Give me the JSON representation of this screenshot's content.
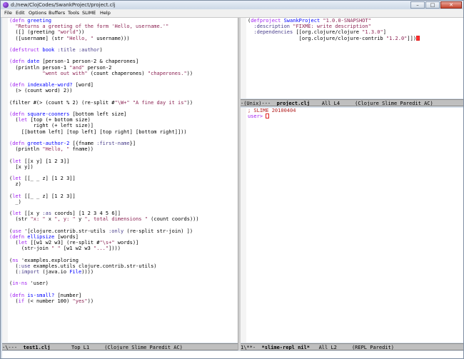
{
  "window": {
    "title": "d:/new/ClojCodes/SwankProject/project.clj",
    "min": "–",
    "max": "□",
    "close": "✕"
  },
  "menu": [
    "File",
    "Edit",
    "Options",
    "Buffers",
    "Tools",
    "SLIME",
    "Help"
  ],
  "left_code": [
    [
      [
        "kw",
        "(defn "
      ],
      [
        "fn",
        "greeting"
      ]
    ],
    [
      [
        "str",
        "  \"Returns a greeting of the form 'Hello, username.'\""
      ]
    ],
    [
      [
        "",
        "  ([] (greeting "
      ],
      [
        "str",
        "\"world\""
      ],
      [
        "",
        "))"
      ]
    ],
    [
      [
        "",
        "  ([username] (str "
      ],
      [
        "str",
        "\"Hello, \""
      ],
      [
        "",
        " username)))"
      ]
    ],
    [
      [
        "",
        ""
      ]
    ],
    [
      [
        "kw",
        "(defstruct "
      ],
      [
        "fn",
        "book"
      ],
      [
        "",
        " "
      ],
      [
        "key",
        ":title :author"
      ],
      [
        "",
        ")"
      ]
    ],
    [
      [
        "",
        ""
      ]
    ],
    [
      [
        "kw",
        "(defn "
      ],
      [
        "fn",
        "date"
      ],
      [
        "",
        " [person-1 person-2 & chaperones]"
      ]
    ],
    [
      [
        "",
        "  (println person-1 "
      ],
      [
        "str",
        "\"and\""
      ],
      [
        "",
        " person-2"
      ]
    ],
    [
      [
        "",
        "           "
      ],
      [
        "str",
        "\"went out with\""
      ],
      [
        "",
        " (count chaperones) "
      ],
      [
        "str",
        "\"chaperones.\""
      ],
      [
        "",
        "))"
      ]
    ],
    [
      [
        "",
        ""
      ]
    ],
    [
      [
        "kw",
        "(defn "
      ],
      [
        "fn",
        "indexable-word?"
      ],
      [
        "",
        " [word]"
      ]
    ],
    [
      [
        "",
        "  (> (count word) 2))"
      ]
    ],
    [
      [
        "",
        ""
      ]
    ],
    [
      [
        "",
        "(filter #(> (count % 2) (re-split #"
      ],
      [
        "str",
        "\"\\W+\" \"A fine day it is\""
      ],
      [
        "",
        "))"
      ]
    ],
    [
      [
        "",
        ""
      ]
    ],
    [
      [
        "kw",
        "(defn "
      ],
      [
        "fn",
        "square-cooners"
      ],
      [
        "",
        " [bottom left size]"
      ]
    ],
    [
      [
        "",
        "  ("
      ],
      [
        "kw",
        "let"
      ],
      [
        "",
        " [top (+ bottom size)"
      ]
    ],
    [
      [
        "",
        "        right (+ left size)]"
      ]
    ],
    [
      [
        "",
        "    [[bottom left] [top left] [top right] [bottom right]]))"
      ]
    ],
    [
      [
        "",
        ""
      ]
    ],
    [
      [
        "kw",
        "(defn "
      ],
      [
        "fn",
        "greet-author-2"
      ],
      [
        "",
        " [{fname "
      ],
      [
        "key",
        ":first-name"
      ],
      [
        "",
        "}]"
      ]
    ],
    [
      [
        "",
        "  (println "
      ],
      [
        "str",
        "\"Hello, \""
      ],
      [
        "",
        " fname))"
      ]
    ],
    [
      [
        "",
        ""
      ]
    ],
    [
      [
        "",
        "("
      ],
      [
        "kw",
        "let"
      ],
      [
        "",
        " [[x y] [1 2 3]]"
      ]
    ],
    [
      [
        "",
        "  [x y])"
      ]
    ],
    [
      [
        "",
        ""
      ]
    ],
    [
      [
        "",
        "("
      ],
      [
        "kw",
        "let"
      ],
      [
        "",
        " [[_ _ z] [1 2 3]]"
      ]
    ],
    [
      [
        "",
        "  z)"
      ]
    ],
    [
      [
        "",
        ""
      ]
    ],
    [
      [
        "",
        "("
      ],
      [
        "kw",
        "let"
      ],
      [
        "",
        " [[_ _ z] [1 2 3]]"
      ]
    ],
    [
      [
        "",
        "  _)"
      ]
    ],
    [
      [
        "",
        ""
      ]
    ],
    [
      [
        "",
        "("
      ],
      [
        "kw",
        "let"
      ],
      [
        "",
        " [[x y "
      ],
      [
        "key",
        ":as"
      ],
      [
        "",
        " coords] [1 2 3 4 5 6]]"
      ]
    ],
    [
      [
        "",
        "  (str "
      ],
      [
        "str",
        "\"x: \""
      ],
      [
        "",
        " x "
      ],
      [
        "str",
        "\", y: \""
      ],
      [
        "",
        " y "
      ],
      [
        "str",
        "\", total dimensions \""
      ],
      [
        "",
        " (count coords)))"
      ]
    ],
    [
      [
        "",
        ""
      ]
    ],
    [
      [
        "",
        "("
      ],
      [
        "kw",
        "use"
      ],
      [
        "",
        " '[clojure.contrib.str-utils "
      ],
      [
        "key",
        ":only"
      ],
      [
        "",
        " (re-split str-join) ])"
      ]
    ],
    [
      [
        "kw",
        "(defn "
      ],
      [
        "fn",
        "ellipsize"
      ],
      [
        "",
        " [words]"
      ]
    ],
    [
      [
        "",
        "  ("
      ],
      [
        "kw",
        "let"
      ],
      [
        "",
        " [[w1 w2 w3] (re-split #"
      ],
      [
        "str",
        "\"\\s+\""
      ],
      [
        "",
        " words)]"
      ]
    ],
    [
      [
        "",
        "    (str-join "
      ],
      [
        "str",
        "\" \""
      ],
      [
        "",
        " [w1 w2 w3 "
      ],
      [
        "str",
        "\"...\""
      ],
      [
        "",
        "])))"
      ]
    ],
    [
      [
        "",
        ""
      ]
    ],
    [
      [
        "",
        "("
      ],
      [
        "kw",
        "ns"
      ],
      [
        "",
        " 'examples.exploring"
      ]
    ],
    [
      [
        "",
        "  ("
      ],
      [
        "key",
        ":use"
      ],
      [
        "",
        " examples.utils clojure.contrib.str-utils)"
      ]
    ],
    [
      [
        "",
        "  ("
      ],
      [
        "key",
        ":import"
      ],
      [
        "",
        " (java.io "
      ],
      [
        "fn",
        "File"
      ],
      [
        "",
        "))))"
      ]
    ],
    [
      [
        "",
        ""
      ]
    ],
    [
      [
        "",
        "("
      ],
      [
        "kw",
        "in-ns"
      ],
      [
        "",
        " 'user)"
      ]
    ],
    [
      [
        "",
        ""
      ]
    ],
    [
      [
        "kw",
        "(defn "
      ],
      [
        "fn",
        "is-small?"
      ],
      [
        "",
        " [number]"
      ]
    ],
    [
      [
        "",
        "  ("
      ],
      [
        "kw",
        "if"
      ],
      [
        "",
        " (< number 100) "
      ],
      [
        "str",
        "\"yes\""
      ],
      [
        "",
        "))"
      ]
    ]
  ],
  "right_top_code": [
    [
      [
        "",
        "("
      ],
      [
        "kw",
        "defproject"
      ],
      [
        "",
        " "
      ],
      [
        "fn",
        "SwankProject"
      ],
      [
        "",
        " "
      ],
      [
        "str",
        "\"1.0.0-SNAPSHOT\""
      ]
    ],
    [
      [
        "",
        "  "
      ],
      [
        "key",
        ":description"
      ],
      [
        "",
        " "
      ],
      [
        "str",
        "\"FIXME: write description\""
      ]
    ],
    [
      [
        "",
        "  "
      ],
      [
        "key",
        ":dependencies"
      ],
      [
        "",
        " [[org.clojure/clojure "
      ],
      [
        "str",
        "\"1.3.0\""
      ],
      [
        "",
        "]"
      ]
    ],
    [
      [
        "",
        "                 [org.clojure/clojure-contrib "
      ],
      [
        "str",
        "\"1.2.0\""
      ],
      [
        "",
        "]])"
      ]
    ]
  ],
  "right_bottom_code": [
    [
      [
        "com",
        "; SLIME 20100404"
      ]
    ],
    [
      [
        "prm",
        "user> "
      ]
    ]
  ],
  "modelines": {
    "left": {
      "pre": "-\\---  ",
      "buf": "test1.clj",
      "post": "       Top L1     (Clojure Slime Paredit AC)"
    },
    "right_top": {
      "pre": "-(Unix)---  ",
      "buf": "project.clj",
      "post": "    All L4     (Clojure Slime Paredit AC)"
    },
    "right_bottom": {
      "pre": "1\\**-  ",
      "buf": "*slime-repl nil*",
      "post": "   All L2     (REPL Paredit)"
    }
  }
}
